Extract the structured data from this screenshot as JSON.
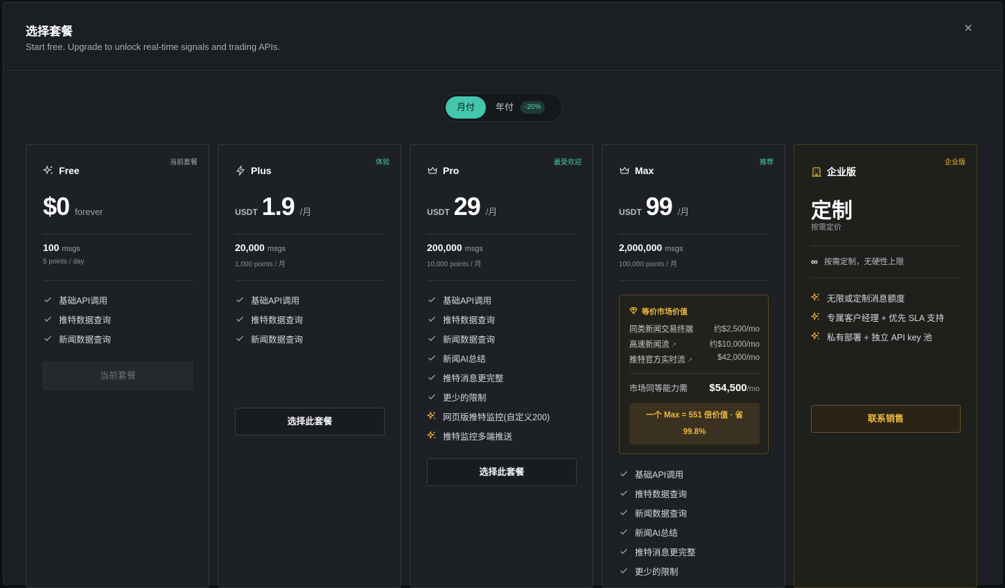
{
  "modal": {
    "title": "选择套餐",
    "subtitle": "Start free. Upgrade to unlock real-time signals and trading APIs.",
    "close_icon": "close-icon"
  },
  "billing": {
    "monthly_label": "月付",
    "yearly_label": "年付",
    "yearly_discount": "-20%",
    "selected": "monthly"
  },
  "colors": {
    "accent": "#43c6ae",
    "gold": "#f0b93b",
    "card_bg": "#1d2024",
    "modal_bg": "#1b1e22"
  },
  "plans": [
    {
      "name": "Free",
      "icon": "sparkles-icon",
      "badge": "当前套餐",
      "currency": "",
      "price": "$0",
      "period": "forever",
      "quota": "100",
      "quota_unit": "msgs",
      "quota_sub": "5 points / day",
      "features": [
        "基础API调用",
        "推特数据查询",
        "新闻数据查询"
      ],
      "cta": "当前套餐"
    },
    {
      "name": "Plus",
      "icon": "lightning-icon",
      "badge": "体验",
      "currency": "USDT",
      "price": "1.9",
      "period": "/月",
      "quota": "20,000",
      "quota_unit": "msgs",
      "quota_sub": "1,000 points / 月",
      "features": [
        "基础API调用",
        "推特数据查询",
        "新闻数据查询"
      ],
      "cta": "选择此套餐"
    },
    {
      "name": "Pro",
      "icon": "crown-icon",
      "badge": "最受欢迎",
      "currency": "USDT",
      "price": "29",
      "period": "/月",
      "quota": "200,000",
      "quota_unit": "msgs",
      "quota_sub": "10,000 points / 月",
      "features": [
        "基础API调用",
        "推特数据查询",
        "新闻数据查询",
        "新闻AI总结",
        "推特消息更完整",
        "更少的限制"
      ],
      "premium_features": [
        "网页版推特监控(自定义200)",
        "推特监控多端推送"
      ],
      "cta": "选择此套餐"
    },
    {
      "name": "Max",
      "icon": "crown-icon",
      "badge": "推荐",
      "currency": "USDT",
      "price": "99",
      "period": "/月",
      "quota": "2,000,000",
      "quota_unit": "msgs",
      "quota_sub": "100,000 points / 月",
      "value_box": {
        "title": "等价市场价值",
        "rows": [
          {
            "name": "同类新闻交易终端",
            "amount": "约$2,500/mo",
            "external": false
          },
          {
            "name": "高速新闻流",
            "amount": "约$10,000/mo",
            "external": true
          },
          {
            "name": "推特官方实时流",
            "amount": "$42,000/mo",
            "external": true
          }
        ],
        "total_label": "市场同等能力需",
        "total_value": "$54,500",
        "total_unit": "/mo",
        "highlight": "一个 Max = 551 倍价值 · 省 99.8%"
      },
      "features": [
        "基础API调用",
        "推特数据查询",
        "新闻数据查询",
        "新闻AI总结",
        "推特消息更完整",
        "更少的限制"
      ]
    },
    {
      "name": "企业版",
      "icon": "building-icon",
      "badge": "企业版",
      "price": "定制",
      "price_sub": "按需定价",
      "custom_line": "按需定制，无硬性上限",
      "features": [
        "无限或定制消息额度",
        "专属客户经理 + 优先 SLA 支持",
        "私有部署 + 独立 API key 池"
      ],
      "cta": "联系销售"
    }
  ]
}
